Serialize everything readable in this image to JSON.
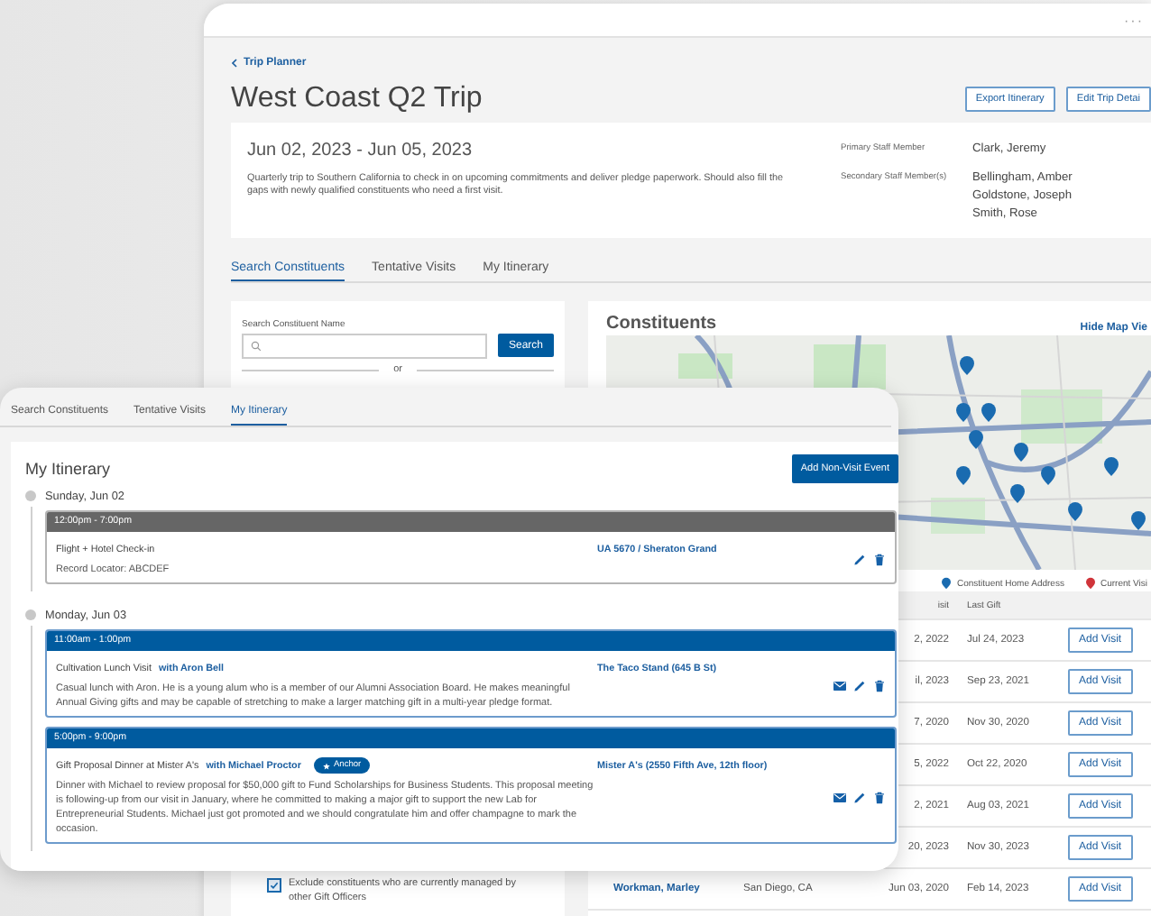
{
  "back_window": {
    "menu_glyph": "···",
    "breadcrumb": "Trip Planner",
    "title": "West Coast Q2 Trip",
    "buttons": [
      "Export Itinerary",
      "Edit Trip Detai"
    ],
    "trip": {
      "dates": "Jun 02, 2023 - Jun 05, 2023",
      "description": "Quarterly trip to Southern California to check in on upcoming commitments and deliver pledge paperwork. Should also fill the gaps with newly qualified constituents who need a first visit.",
      "primary_label": "Primary Staff Member",
      "primary": "Clark, Jeremy",
      "secondary_label": "Secondary Staff Member(s)",
      "secondary": [
        "Bellingham, Amber",
        "Goldstone, Joseph",
        "Smith, Rose"
      ]
    },
    "tabs": [
      {
        "label": "Search Constituents",
        "selected": true
      },
      {
        "label": "Tentative Visits",
        "selected": false
      },
      {
        "label": "My Itinerary",
        "selected": false
      }
    ],
    "search": {
      "label": "Search Constituent Name",
      "button": "Search",
      "divider": "or",
      "exclude": {
        "label": "Exclude constituents who are currently managed by other Gift Officers",
        "checked": true
      }
    },
    "constituents": {
      "title": "Constituents",
      "toggle": "Hide Map Vie",
      "legend": [
        {
          "label": "Constituent Home Address",
          "color": "#1a6bb0"
        },
        {
          "label": "Current Visi",
          "color": "#d0343a"
        }
      ],
      "columns": [
        "isit",
        "Last Gift"
      ],
      "rows": [
        {
          "last_visit": "2, 2022",
          "last_gift": "Jul 24, 2023",
          "action": "Add Visit"
        },
        {
          "last_visit": "il, 2023",
          "last_gift": "Sep 23, 2021",
          "action": "Add Visit"
        },
        {
          "last_visit": "7, 2020",
          "last_gift": "Nov 30, 2020",
          "action": "Add Visit"
        },
        {
          "last_visit": "5, 2022",
          "last_gift": "Oct 22, 2020",
          "action": "Add Visit"
        },
        {
          "last_visit": "2, 2021",
          "last_gift": "Aug 03, 2021",
          "action": "Add Visit"
        },
        {
          "last_visit": "20, 2023",
          "last_gift": "Nov 30, 2023",
          "action": "Add Visit"
        },
        {
          "name": "Workman, Marley",
          "city": "San Diego, CA",
          "last_visit": "Jun 03, 2020",
          "last_gift": "Feb 14, 2023",
          "action": "Add Visit"
        }
      ]
    }
  },
  "itinerary": {
    "tabs": [
      {
        "label": "Search Constituents",
        "selected": false
      },
      {
        "label": "Tentative Visits",
        "selected": false
      },
      {
        "label": "My Itinerary",
        "selected": true
      }
    ],
    "title": "My Itinerary",
    "add_button": "Add Non-Visit Event",
    "days": [
      {
        "label": "Sunday, Jun 02",
        "events": [
          {
            "kind": "personal",
            "time": "12:00pm - 7:00pm",
            "title": "Flight + Hotel Check-in",
            "details": "Record Locator: ABCDEF",
            "location": "UA 5670 / Sheraton Grand"
          }
        ]
      },
      {
        "label": "Monday, Jun 03",
        "events": [
          {
            "kind": "visit",
            "time": "11:00am - 1:00pm",
            "title": "Cultivation Lunch Visit",
            "with": "with Aron Bell",
            "details": "Casual lunch with Aron. He is a young alum who is a member of our Alumni Association Board. He makes meaningful Annual Giving gifts and may be capable of stretching to make a larger matching gift in a multi-year pledge format.",
            "location": "The Taco Stand (645 B St)"
          },
          {
            "kind": "visit",
            "time": "5:00pm - 9:00pm",
            "title": "Gift Proposal Dinner at Mister A's",
            "with": "with Michael Proctor",
            "badge": "Anchor",
            "details": "Dinner with Michael to review proposal for $50,000 gift to Fund Scholarships for Business Students. This proposal meeting is following-up from our visit in January, where he committed to making a major gift to support the new Lab for Entrepreneurial Students. Michael just got promoted and we should congratulate him and offer champagne to mark the occasion.",
            "location": "Mister A's (2550 Fifth Ave, 12th floor)"
          }
        ]
      }
    ]
  }
}
